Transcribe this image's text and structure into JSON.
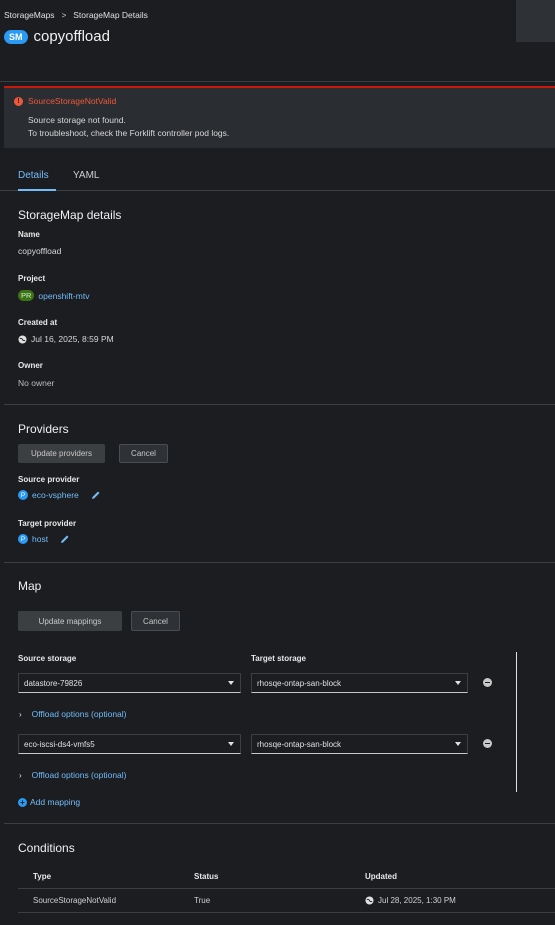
{
  "breadcrumb": {
    "parent": "StorageMaps",
    "current": "StorageMap Details",
    "separator": ">"
  },
  "header": {
    "badge": "SM",
    "title": "copyoffload"
  },
  "alert": {
    "title": "SourceStorageNotValid",
    "line1": "Source storage not found.",
    "line2": "To troubleshoot, check the Forklift controller pod logs."
  },
  "tabs": [
    {
      "label": "Details",
      "active": true
    },
    {
      "label": "YAML",
      "active": false
    }
  ],
  "details": {
    "heading": "StorageMap details",
    "name_label": "Name",
    "name_value": "copyoffload",
    "project_label": "Project",
    "project_badge": "PR",
    "project_value": "openshift-mtv",
    "created_label": "Created at",
    "created_value": "Jul 16, 2025, 8:59 PM",
    "owner_label": "Owner",
    "owner_value": "No owner"
  },
  "providers": {
    "heading": "Providers",
    "update_button": "Update providers",
    "cancel_button": "Cancel",
    "source_label": "Source provider",
    "source_badge": "P",
    "source_value": "eco-vsphere",
    "target_label": "Target provider",
    "target_badge": "P",
    "target_value": "host"
  },
  "map": {
    "heading": "Map",
    "update_button": "Update mappings",
    "cancel_button": "Cancel",
    "source_header": "Source storage",
    "target_header": "Target storage",
    "rows": [
      {
        "source": "datastore-79826",
        "target": "rhosqe-ontap-san-block",
        "offload": "Offload options (optional)"
      },
      {
        "source": "eco-iscsi-ds4-vmfs5",
        "target": "rhosqe-ontap-san-block",
        "offload": "Offload options (optional)"
      }
    ],
    "add_mapping": "Add mapping"
  },
  "conditions": {
    "heading": "Conditions",
    "columns": [
      "Type",
      "Status",
      "Updated"
    ],
    "rows": [
      {
        "type": "SourceStorageNotValid",
        "status": "True",
        "updated": "Jul 28, 2025, 1:30 PM"
      }
    ]
  },
  "colors": {
    "accent": "#73bcf7",
    "danger": "#f0583a",
    "background": "#1b1d21"
  },
  "icons": {
    "alert": "exclamation-circle-icon",
    "created": "globe-icon",
    "edit": "pencil-icon",
    "add": "plus-circle-icon",
    "remove": "minus-circle-icon"
  }
}
